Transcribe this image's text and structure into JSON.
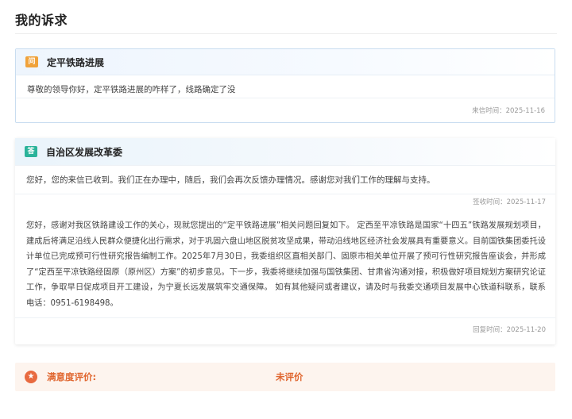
{
  "page": {
    "title": "我的诉求"
  },
  "question": {
    "badge": "问",
    "title": "定平铁路进展",
    "content": "尊敬的领导你好，定平铁路进展的咋样了，线路确定了没",
    "time": "来信时间：2025-11-16"
  },
  "answer": {
    "badge": "答",
    "department": "自治区发展改革委",
    "brief": "您好，您的来信已收到。我们正在办理中，随后，我们会再次反馈办理情况。感谢您对我们工作的理解与支持。",
    "sign_time": "签收时间：2025-11-17",
    "body": "您好，感谢对我区铁路建设工作的关心，现就您提出的“定平铁路进展”相关问题回复如下。 定西至平凉铁路是国家“十四五”铁路发展规划项目，建成后将满足沿线人民群众便捷化出行需求，对于巩固六盘山地区脱贫攻坚成果，带动沿线地区经济社会发展具有重要意义。目前国铁集团委托设计单位已完成预可行性研究报告编制工作。2025年7月30日，我委组织区直相关部门、固原市相关单位开展了预可行性研究报告座谈会，并形成了“定西至平凉铁路经固原（原州区）方案”的初步意见。下一步，我委将继续加强与国铁集团、甘肃省沟通对接，积极做好项目规划方案研究论证工作，争取早日促成项目开工建设，为宁夏长远发展筑牢交通保障。 如有其他疑问或者建议，请及时与我委交通项目发展中心铁道科联系，联系电话：0951-6198498。",
    "reply_time": "回复时间：2025-11-20"
  },
  "satisfaction": {
    "icon": "star-icon",
    "label": "满意度评价:",
    "value": "未评价"
  },
  "colors": {
    "ask_badge": "#f0a23a",
    "answer_badge": "#2bb39a",
    "accent": "#e0662f"
  }
}
